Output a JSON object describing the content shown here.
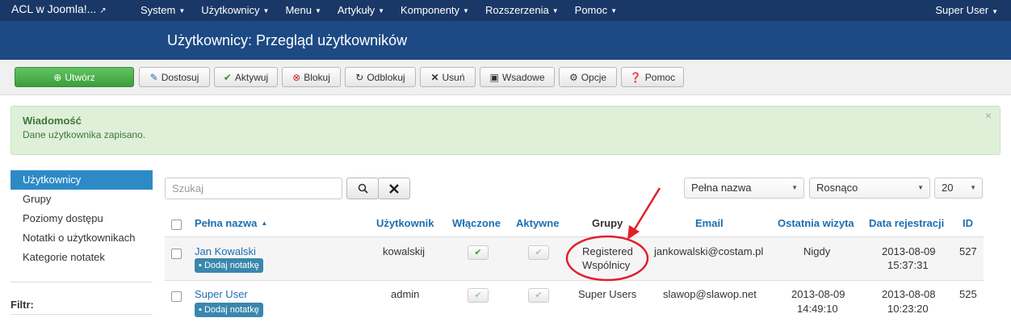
{
  "navbar": {
    "brand": "ACL w Joomla!...",
    "menu": [
      "System",
      "Użytkownicy",
      "Menu",
      "Artykuły",
      "Komponenty",
      "Rozszerzenia",
      "Pomoc"
    ],
    "user": "Super User"
  },
  "header": {
    "title": "Użytkownicy: Przegląd użytkowników"
  },
  "toolbar": {
    "create": "Utwórz",
    "edit": "Dostosuj",
    "activate": "Aktywuj",
    "block": "Blokuj",
    "unblock": "Odblokuj",
    "delete": "Usuń",
    "batch": "Wsadowe",
    "options": "Opcje",
    "help": "Pomoc"
  },
  "message": {
    "title": "Wiadomość",
    "text": "Dane użytkownika zapisano.",
    "close": "×"
  },
  "sidebar": {
    "items": [
      "Użytkownicy",
      "Grupy",
      "Poziomy dostępu",
      "Notatki o użytkownikach",
      "Kategorie notatek"
    ],
    "filter_label": "Filtr:"
  },
  "search": {
    "placeholder": "Szukaj",
    "sort_field": "Pełna nazwa",
    "sort_dir": "Rosnąco",
    "limit": "20"
  },
  "table": {
    "headers": {
      "name": "Pełna nazwa",
      "username": "Użytkownik",
      "enabled": "Włączone",
      "active": "Aktywne",
      "groups": "Grupy",
      "email": "Email",
      "last_visit": "Ostatnia wizyta",
      "registered": "Data rejestracji",
      "id": "ID"
    },
    "rows": [
      {
        "name": "Jan Kowalski",
        "note": "Dodaj notatkę",
        "username": "kowalskij",
        "groups_1": "Registered",
        "groups_2": "Wspólnicy",
        "email": "jankowalski@costam.pl",
        "last_visit": "Nigdy",
        "last_visit_2": "",
        "reg_date": "2013-08-09",
        "reg_time": "15:37:31",
        "id": "527"
      },
      {
        "name": "Super User",
        "note": "Dodaj notatkę",
        "username": "admin",
        "groups_1": "Super Users",
        "groups_2": "",
        "email": "slawop@slawop.net",
        "last_visit": "2013-08-09",
        "last_visit_2": "14:49:10",
        "reg_date": "2013-08-08",
        "reg_time": "10:23:20",
        "id": "525"
      }
    ]
  },
  "colors": {
    "navbar": "#1a3867",
    "header": "#1d4a84",
    "link": "#1d6eb0",
    "annotation": "#e0202a"
  }
}
